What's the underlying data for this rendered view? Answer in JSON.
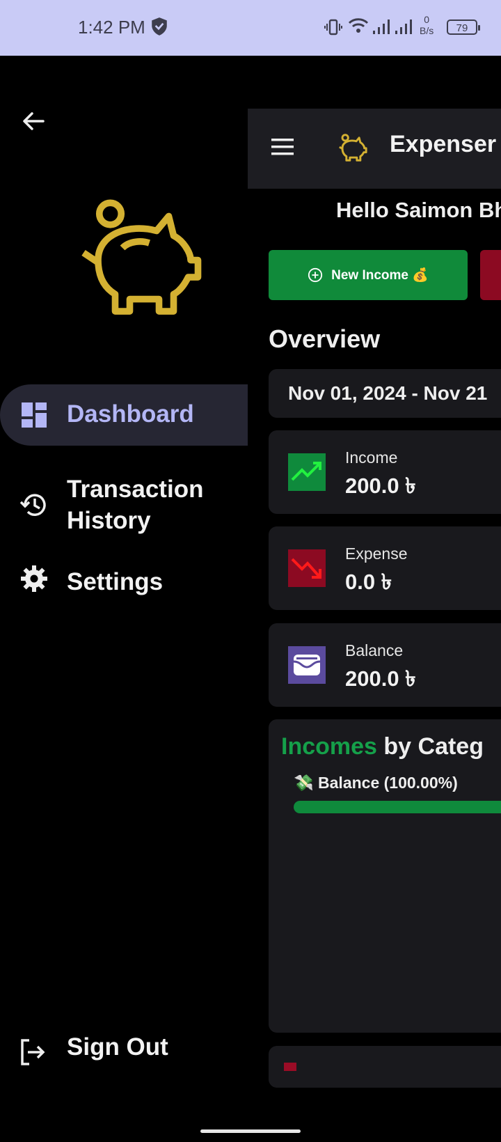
{
  "status": {
    "time": "1:42 PM",
    "net_top": "0",
    "net_bottom": "B/s",
    "battery": "79"
  },
  "drawer": {
    "nav": [
      {
        "label": "Dashboard"
      },
      {
        "label": "Transaction History"
      },
      {
        "label": "Settings"
      }
    ],
    "signout": "Sign Out"
  },
  "main": {
    "app_title": "Expenser",
    "greeting": "Hello Saimon Bh",
    "new_income_label": "New Income 💰",
    "overview_title": "Overview",
    "date_range": "Nov 01, 2024  -  Nov 21",
    "stats": {
      "income": {
        "label": "Income",
        "value": "200.0 ৳"
      },
      "expense": {
        "label": "Expense",
        "value": "0.0 ৳"
      },
      "balance": {
        "label": "Balance",
        "value": "200.0 ৳"
      }
    },
    "incomes_card": {
      "title_colored": "Incomes",
      "title_rest": " by Categ",
      "item": "💸 Balance (100.00%)"
    }
  },
  "colors": {
    "accent": "#b3b6f5",
    "income_green": "#108a3a",
    "expense_red": "#8c0a22",
    "logo_gold": "#d4b132",
    "balance_purple": "#5b4b9e"
  },
  "icons": [
    "back-arrow-icon",
    "piggy-bank-icon",
    "dashboard-icon",
    "history-icon",
    "gear-icon",
    "logout-icon",
    "menu-icon",
    "trending-up-icon",
    "trending-down-icon",
    "wallet-icon"
  ]
}
